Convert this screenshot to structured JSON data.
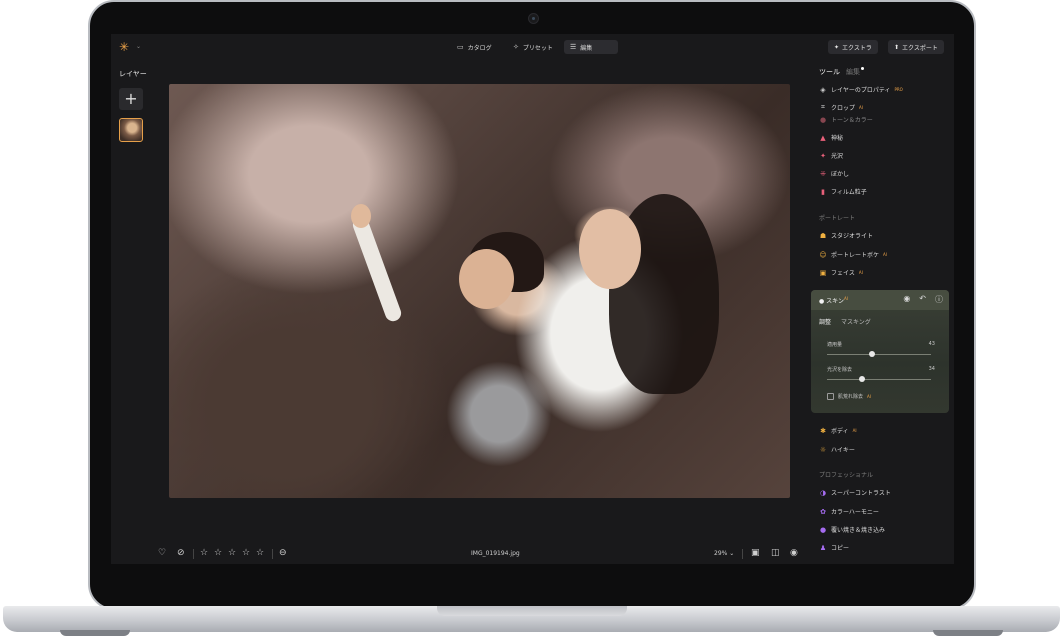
{
  "topbar": {
    "tabs": [
      {
        "label": "カタログ",
        "icon": "catalog-icon"
      },
      {
        "label": "プリセット",
        "icon": "preset-icon"
      },
      {
        "label": "編集",
        "icon": "sliders-icon",
        "active": true
      }
    ],
    "extra_label": "エクストラ",
    "export_label": "エクスポート"
  },
  "layers": {
    "title": "レイヤー",
    "add": "+"
  },
  "photo": {
    "filename": "IMG_019194.jpg"
  },
  "bottombar": {
    "zoom": "29%",
    "rating_max": 5
  },
  "panel": {
    "tab_tools": "ツール",
    "tab_edit": "編集",
    "items_top": [
      {
        "label": "レイヤーのプロパティ",
        "badge": "PRO",
        "icon": "layers-icon",
        "color": "#cfcfcf"
      },
      {
        "label": "クロップ",
        "badge": "AI",
        "icon": "crop-icon",
        "color": "#cfcfcf"
      },
      {
        "label": "トーン＆カラー",
        "icon": "tone-icon",
        "color": "#e06a7a"
      },
      {
        "label": "神秘",
        "icon": "mystic-icon",
        "color": "#e8607a"
      },
      {
        "label": "光沢",
        "icon": "glow-icon",
        "color": "#e8607a"
      },
      {
        "label": "ぼかし",
        "icon": "blur-icon",
        "color": "#e8607a"
      },
      {
        "label": "フィルム粒子",
        "icon": "film-grain-icon",
        "color": "#e8607a"
      }
    ],
    "section_portrait": "ポートレート",
    "items_portrait": [
      {
        "label": "スタジオライト",
        "icon": "studio-light-icon",
        "color": "#f0b040"
      },
      {
        "label": "ポートレートボケ",
        "badge": "AI",
        "icon": "bokeh-icon",
        "color": "#f0b040"
      },
      {
        "label": "フェイス",
        "badge": "AI",
        "icon": "face-icon",
        "color": "#f0b040"
      }
    ],
    "skin": {
      "title": "スキン",
      "badge": "AI",
      "tab_adjust": "調整",
      "tab_mask": "マスキング",
      "slider1_label": "適用量",
      "slider1_value": "43",
      "slider1_pct": 43,
      "slider2_label": "光沢を除去",
      "slider2_value": "34",
      "slider2_pct": 34,
      "checkbox_label": "肌荒れ除去",
      "checkbox_badge": "AI"
    },
    "items_after_skin": [
      {
        "label": "ボディ",
        "badge": "AI",
        "icon": "body-icon",
        "color": "#f0b040"
      },
      {
        "label": "ハイキー",
        "icon": "high-key-icon",
        "color": "#f0b040"
      }
    ],
    "section_pro": "プロフェッショナル",
    "items_pro": [
      {
        "label": "スーパーコントラスト",
        "icon": "contrast-icon",
        "color": "#a56cf0"
      },
      {
        "label": "カラーハーモニー",
        "icon": "color-harmony-icon",
        "color": "#a56cf0"
      },
      {
        "label": "覆い焼き＆焼き込み",
        "icon": "dodge-burn-icon",
        "color": "#a56cf0"
      },
      {
        "label": "コピー",
        "icon": "clone-icon",
        "color": "#a56cf0"
      }
    ]
  }
}
